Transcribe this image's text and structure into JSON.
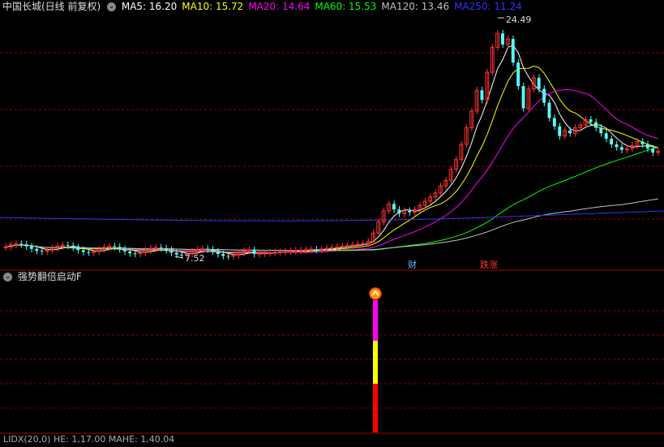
{
  "main_header": {
    "title": "中国长城(日线 前复权)",
    "ma": [
      {
        "label": "MA5: 16.20",
        "color": "#ffffff"
      },
      {
        "label": "MA10: 15.72",
        "color": "#ffff00"
      },
      {
        "label": "MA20: 14.64",
        "color": "#ff00ff"
      },
      {
        "label": "MA60: 15.53",
        "color": "#00ff00"
      },
      {
        "label": "MA120: 13.46",
        "color": "#c0c0c0"
      },
      {
        "label": "MA250: 11.24",
        "color": "#3333ff"
      }
    ]
  },
  "chart": {
    "high_label": "24.49",
    "low_label": "7.52",
    "markers": [
      {
        "text": "财",
        "color": "#5fb7ff"
      },
      {
        "text": "跌涨",
        "color": "#ff3333"
      }
    ]
  },
  "indicator_panel": {
    "title": "强势翻倍启动F",
    "signal_icon": "up-chevron-signal-icon",
    "segments": [
      {
        "color": "#ff00ff"
      },
      {
        "color": "#ffff00"
      },
      {
        "color": "#ff0000"
      }
    ]
  },
  "footer": {
    "text": "LIDX(20,0) HE: 1,17.00 MAHE: 1,40.04"
  },
  "colors": {
    "up": "#ff3232",
    "down": "#54ffff",
    "grid": "#8b0000"
  }
}
